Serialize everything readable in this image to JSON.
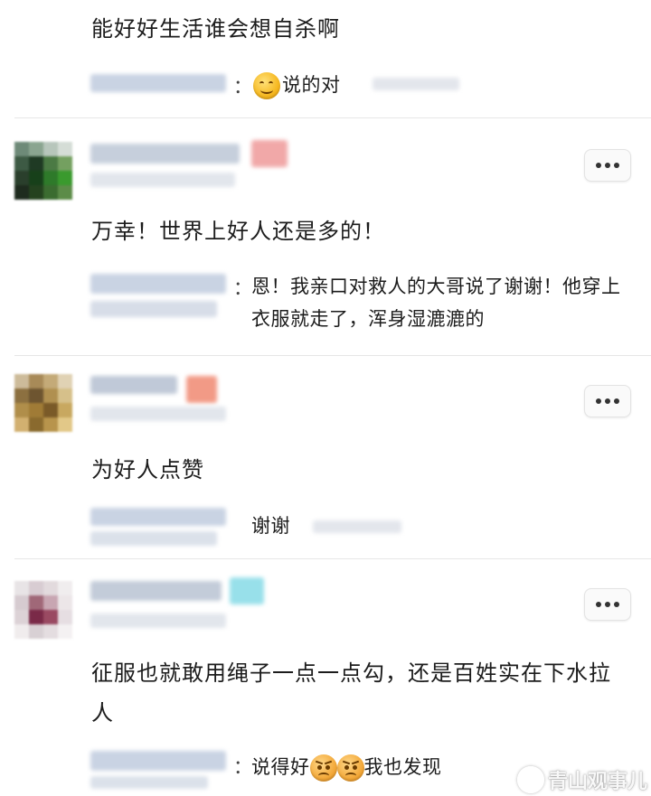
{
  "comments": [
    {
      "body": "能好好生活谁会想自杀啊",
      "reply": {
        "text": "说的对",
        "emoji": [
          "smile-emoji"
        ]
      }
    },
    {
      "body": "万幸！世界上好人还是多的！",
      "reply": {
        "text": "恩！我亲口对救人的大哥说了谢谢！他穿上衣服就走了，浑身湿漉漉的"
      }
    },
    {
      "body": "为好人点赞",
      "reply": {
        "text": "谢谢"
      }
    },
    {
      "body": "征服也就敢用绳子一点一点勾，还是百姓实在下水拉人",
      "reply": {
        "before": "说得好",
        "after": "我也发现",
        "emoji": [
          "angry-emoji",
          "angry-emoji"
        ]
      }
    }
  ],
  "reply_separator": "：",
  "watermark": {
    "text": "青山观事儿"
  },
  "icons": [
    "more-options-icon",
    "smile-emoji",
    "angry-emoji"
  ],
  "colors": {
    "text": "#1c1c1c",
    "divider": "#e6e6e6",
    "button_bg": "#fafafa"
  }
}
